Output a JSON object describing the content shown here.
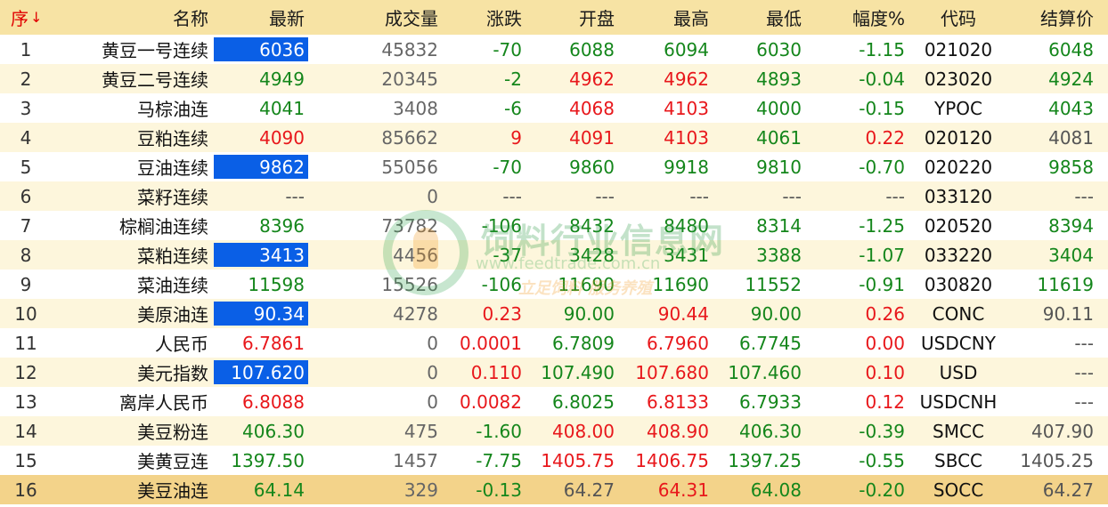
{
  "headers": {
    "seq": "序",
    "seq_arrow": "↓",
    "name": "名称",
    "new": "最新",
    "volume": "成交量",
    "change": "涨跌",
    "open": "开盘",
    "high": "最高",
    "low": "最低",
    "pct": "幅度%",
    "code": "代码",
    "settle": "结算价"
  },
  "colors": {
    "up": "#e8171b",
    "down": "#14861b",
    "flat": "#555555",
    "highlight": "#0a5fe6",
    "header_bg": "#f7e3a4",
    "stripe_bg": "#fdf6dc",
    "selected_bg": "#f3d38a"
  },
  "rows": [
    {
      "seq": "1",
      "name": "黄豆一号连续",
      "new": "6036",
      "new_c": "hl",
      "volume": "45832",
      "change": "-70",
      "change_c": "down",
      "open": "6088",
      "open_c": "down",
      "high": "6094",
      "high_c": "down",
      "low": "6030",
      "low_c": "down",
      "pct": "-1.15",
      "pct_c": "down",
      "code": "021020",
      "settle": "6048",
      "settle_c": "down"
    },
    {
      "seq": "2",
      "name": "黄豆二号连续",
      "new": "4949",
      "new_c": "down",
      "volume": "20345",
      "change": "-2",
      "change_c": "down",
      "open": "4962",
      "open_c": "up",
      "high": "4962",
      "high_c": "up",
      "low": "4893",
      "low_c": "down",
      "pct": "-0.04",
      "pct_c": "down",
      "code": "023020",
      "settle": "4924",
      "settle_c": "down"
    },
    {
      "seq": "3",
      "name": "马棕油连",
      "new": "4041",
      "new_c": "down",
      "volume": "3408",
      "change": "-6",
      "change_c": "down",
      "open": "4068",
      "open_c": "up",
      "high": "4103",
      "high_c": "up",
      "low": "4000",
      "low_c": "down",
      "pct": "-0.15",
      "pct_c": "down",
      "code": "YPOC",
      "settle": "4043",
      "settle_c": "down"
    },
    {
      "seq": "4",
      "name": "豆粕连续",
      "new": "4090",
      "new_c": "up",
      "volume": "85662",
      "change": "9",
      "change_c": "up",
      "open": "4091",
      "open_c": "up",
      "high": "4103",
      "high_c": "up",
      "low": "4061",
      "low_c": "down",
      "pct": "0.22",
      "pct_c": "up",
      "code": "020120",
      "settle": "4081",
      "settle_c": "flat"
    },
    {
      "seq": "5",
      "name": "豆油连续",
      "new": "9862",
      "new_c": "hl",
      "volume": "55056",
      "change": "-70",
      "change_c": "down",
      "open": "9860",
      "open_c": "down",
      "high": "9918",
      "high_c": "down",
      "low": "9810",
      "low_c": "down",
      "pct": "-0.70",
      "pct_c": "down",
      "code": "020220",
      "settle": "9858",
      "settle_c": "down"
    },
    {
      "seq": "6",
      "name": "菜籽连续",
      "new": "---",
      "new_c": "flat",
      "volume": "0",
      "change": "---",
      "change_c": "flat",
      "open": "---",
      "open_c": "flat",
      "high": "---",
      "high_c": "flat",
      "low": "---",
      "low_c": "flat",
      "pct": "---",
      "pct_c": "flat",
      "code": "033120",
      "settle": "---",
      "settle_c": "flat"
    },
    {
      "seq": "7",
      "name": "棕榈油连续",
      "new": "8396",
      "new_c": "down",
      "volume": "73782",
      "change": "-106",
      "change_c": "down",
      "open": "8432",
      "open_c": "down",
      "high": "8480",
      "high_c": "down",
      "low": "8314",
      "low_c": "down",
      "pct": "-1.25",
      "pct_c": "down",
      "code": "020520",
      "settle": "8394",
      "settle_c": "down"
    },
    {
      "seq": "8",
      "name": "菜粕连续",
      "new": "3413",
      "new_c": "hl",
      "volume": "4456",
      "change": "-37",
      "change_c": "down",
      "open": "3428",
      "open_c": "down",
      "high": "3431",
      "high_c": "down",
      "low": "3388",
      "low_c": "down",
      "pct": "-1.07",
      "pct_c": "down",
      "code": "033220",
      "settle": "3404",
      "settle_c": "down"
    },
    {
      "seq": "9",
      "name": "菜油连续",
      "new": "11598",
      "new_c": "down",
      "volume": "15526",
      "change": "-106",
      "change_c": "down",
      "open": "11690",
      "open_c": "down",
      "high": "11690",
      "high_c": "down",
      "low": "11552",
      "low_c": "down",
      "pct": "-0.91",
      "pct_c": "down",
      "code": "030820",
      "settle": "11619",
      "settle_c": "down"
    },
    {
      "seq": "10",
      "name": "美原油连",
      "new": "90.34",
      "new_c": "hl",
      "volume": "4278",
      "change": "0.23",
      "change_c": "up",
      "open": "90.00",
      "open_c": "down",
      "high": "90.44",
      "high_c": "up",
      "low": "90.00",
      "low_c": "down",
      "pct": "0.26",
      "pct_c": "up",
      "code": "CONC",
      "settle": "90.11",
      "settle_c": "flat"
    },
    {
      "seq": "11",
      "name": "人民币",
      "new": "6.7861",
      "new_c": "up",
      "volume": "0",
      "change": "0.0001",
      "change_c": "up",
      "open": "6.7809",
      "open_c": "down",
      "high": "6.7960",
      "high_c": "up",
      "low": "6.7745",
      "low_c": "down",
      "pct": "0.00",
      "pct_c": "up",
      "code": "USDCNY",
      "settle": "---",
      "settle_c": "flat"
    },
    {
      "seq": "12",
      "name": "美元指数",
      "new": "107.620",
      "new_c": "hl",
      "volume": "0",
      "change": "0.110",
      "change_c": "up",
      "open": "107.490",
      "open_c": "down",
      "high": "107.680",
      "high_c": "up",
      "low": "107.460",
      "low_c": "down",
      "pct": "0.10",
      "pct_c": "up",
      "code": "USD",
      "settle": "---",
      "settle_c": "flat"
    },
    {
      "seq": "13",
      "name": "离岸人民币",
      "new": "6.8088",
      "new_c": "up",
      "volume": "0",
      "change": "0.0082",
      "change_c": "up",
      "open": "6.8025",
      "open_c": "down",
      "high": "6.8133",
      "high_c": "up",
      "low": "6.7933",
      "low_c": "down",
      "pct": "0.12",
      "pct_c": "up",
      "code": "USDCNH",
      "settle": "---",
      "settle_c": "flat"
    },
    {
      "seq": "14",
      "name": "美豆粉连",
      "new": "406.30",
      "new_c": "down",
      "volume": "475",
      "change": "-1.60",
      "change_c": "down",
      "open": "408.00",
      "open_c": "up",
      "high": "408.90",
      "high_c": "up",
      "low": "406.30",
      "low_c": "down",
      "pct": "-0.39",
      "pct_c": "down",
      "code": "SMCC",
      "settle": "407.90",
      "settle_c": "flat"
    },
    {
      "seq": "15",
      "name": "美黄豆连",
      "new": "1397.50",
      "new_c": "down",
      "volume": "1457",
      "change": "-7.75",
      "change_c": "down",
      "open": "1405.75",
      "open_c": "up",
      "high": "1406.75",
      "high_c": "up",
      "low": "1397.25",
      "low_c": "down",
      "pct": "-0.55",
      "pct_c": "down",
      "code": "SBCC",
      "settle": "1405.25",
      "settle_c": "flat"
    },
    {
      "seq": "16",
      "name": "美豆油连",
      "new": "64.14",
      "new_c": "down",
      "volume": "329",
      "change": "-0.13",
      "change_c": "down",
      "open": "64.27",
      "open_c": "flat",
      "high": "64.31",
      "high_c": "up",
      "low": "64.08",
      "low_c": "down",
      "pct": "-0.20",
      "pct_c": "down",
      "code": "SOCC",
      "settle": "64.27",
      "settle_c": "flat",
      "selected": true
    }
  ],
  "watermark": {
    "title": "饲料行业信息网",
    "url": "www.feedtrade.com.cn",
    "slogan": "立足饲料 服务养殖"
  }
}
